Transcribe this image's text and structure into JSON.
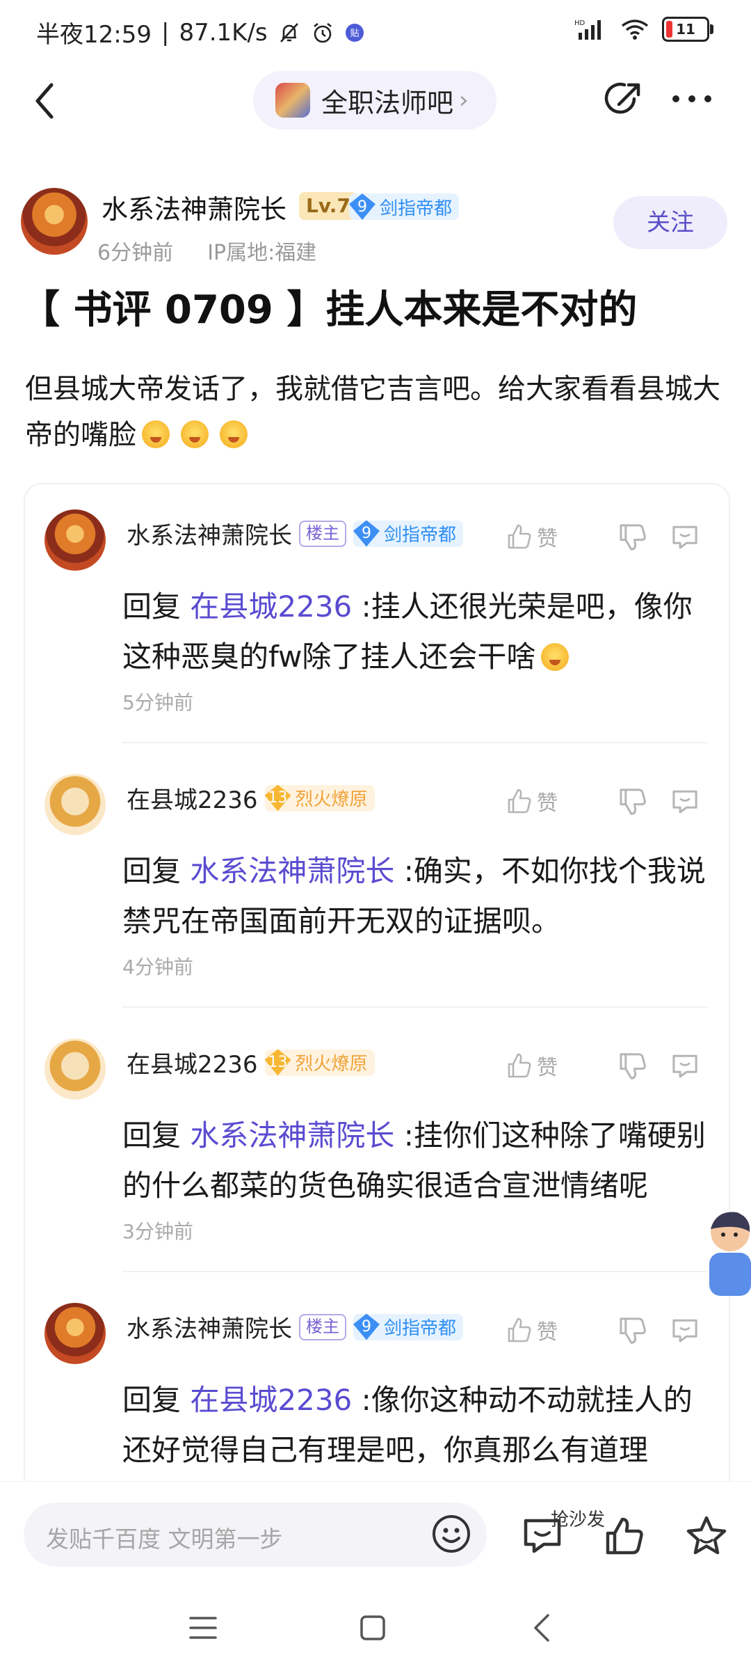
{
  "status_bar": {
    "time": "半夜12:59",
    "net_speed": "87.1K/s",
    "battery": "11"
  },
  "nav": {
    "forum_name": "全职法师吧"
  },
  "post": {
    "author": "水系法神萧院长",
    "level": "Lv.7",
    "honor_level": "9",
    "honor_title": "剑指帝都",
    "time": "6分钟前",
    "ip": "IP属地:福建",
    "follow_label": "关注",
    "title": "【 书评 0709 】挂人本来是不对的",
    "body": "但县城大帝发话了，我就借它吉言吧。给大家看看县城大帝的嘴脸"
  },
  "replies": [
    {
      "author": "水系法神萧院长",
      "host_tag": "楼主",
      "honor_level": "9",
      "honor_title": "剑指帝都",
      "like_label": "赞",
      "reply_prefix": "回复",
      "reply_to": "在县城2236",
      "text": ":挂人还很光荣是吧，像你这种恶臭的fw除了挂人还会干啥",
      "time": "5分钟前"
    },
    {
      "author": "在县城2236",
      "honor_level": "13",
      "honor_title": "烈火燎原",
      "like_label": "赞",
      "reply_prefix": "回复",
      "reply_to": "水系法神萧院长",
      "text": ":确实，不如你找个我说禁咒在帝国面前开无双的证据呗。",
      "time": "4分钟前"
    },
    {
      "author": "在县城2236",
      "honor_level": "13",
      "honor_title": "烈火燎原",
      "like_label": "赞",
      "reply_prefix": "回复",
      "reply_to": "水系法神萧院长",
      "text": ":挂你们这种除了嘴硬别的什么都菜的货色确实很适合宣泄情绪呢",
      "time": "3分钟前"
    },
    {
      "author": "水系法神萧院长",
      "host_tag": "楼主",
      "honor_level": "9",
      "honor_title": "剑指帝都",
      "like_label": "赞",
      "reply_prefix": "回复",
      "reply_to": "在县城2236",
      "text": ":像你这种动不动就挂人的还好觉得自己有理是吧，你真那么有道理"
    }
  ],
  "bottom_bar": {
    "input_placeholder": "发贴千百度 文明第一步",
    "sofa_label": "抢沙发"
  },
  "colors": {
    "accent": "#5a4bd1",
    "follow_bg": "#efedfb",
    "honor_blue": "#2f8ef2",
    "honor_orange": "#f0a23a",
    "level_bg": "#fbe6b7"
  }
}
